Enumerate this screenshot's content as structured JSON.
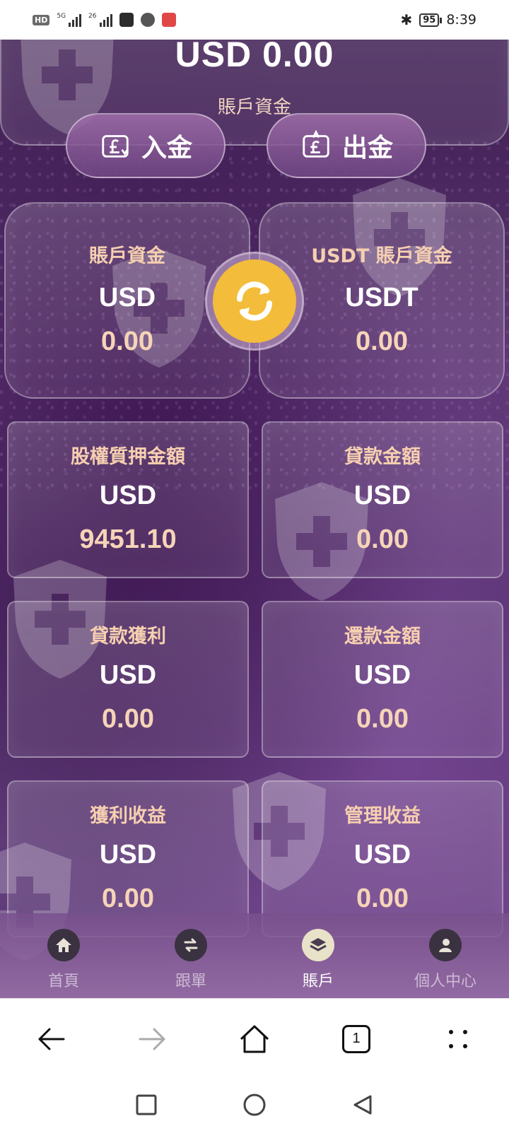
{
  "status_bar": {
    "hd_label": "HD",
    "sim1_label": "5G",
    "sim2_label": "26",
    "battery": "95",
    "time": "8:39"
  },
  "account": {
    "total_amount": "USD 0.00",
    "total_label": "賬戶資金",
    "deposit_label": "入金",
    "withdraw_label": "出金"
  },
  "balances": [
    {
      "title": "賬戶資金",
      "currency": "USD",
      "value": "0.00"
    },
    {
      "title": "USDT 賬戶資金",
      "currency": "USDT",
      "value": "0.00"
    }
  ],
  "stats": [
    {
      "title": "股權質押金額",
      "currency": "USD",
      "value": "9451.10"
    },
    {
      "title": "貸款金額",
      "currency": "USD",
      "value": "0.00"
    },
    {
      "title": "貸款獲利",
      "currency": "USD",
      "value": "0.00"
    },
    {
      "title": "還款金額",
      "currency": "USD",
      "value": "0.00"
    },
    {
      "title": "獲利收益",
      "currency": "USD",
      "value": "0.00"
    },
    {
      "title": "管理收益",
      "currency": "USD",
      "value": "0.00"
    }
  ],
  "tabs": [
    {
      "label": "首頁",
      "icon": "home-icon"
    },
    {
      "label": "跟單",
      "icon": "swap-icon"
    },
    {
      "label": "賬戶",
      "icon": "layers-icon",
      "active": true
    },
    {
      "label": "個人中心",
      "icon": "user-icon"
    }
  ],
  "browser": {
    "tab_count": "1"
  },
  "colors": {
    "accent_gold": "#f3bc3a",
    "label_peach": "#f6cfb0",
    "value_peach": "#f6d4b8",
    "bg_purple": "#4e2c64"
  }
}
